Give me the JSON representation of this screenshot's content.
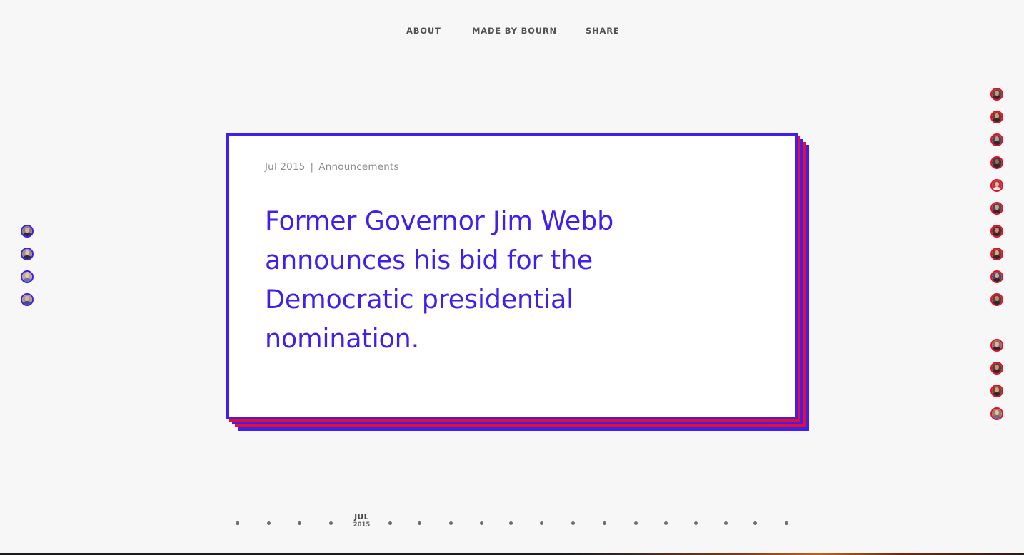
{
  "nav": {
    "about": "ABOUT",
    "made_by": "MADE BY BOURN",
    "share": "SHARE"
  },
  "card": {
    "date": "Jul 2015",
    "separator": "|",
    "category": "Announcements",
    "headline": "Former Governor Jim Webb announces his bid for the Democratic presidential nomination."
  },
  "timeline": {
    "current_month": "JUL",
    "current_year": "2015"
  },
  "colors": {
    "democrat": "#3d1ff2",
    "republican": "#ea0e2a",
    "background": "#f7f7f7",
    "headline": "#3d1ff2"
  },
  "icons": {
    "democrat_avatar": "candidate-portrait",
    "republican_avatar": "candidate-portrait",
    "timeline_dot": "dot"
  }
}
